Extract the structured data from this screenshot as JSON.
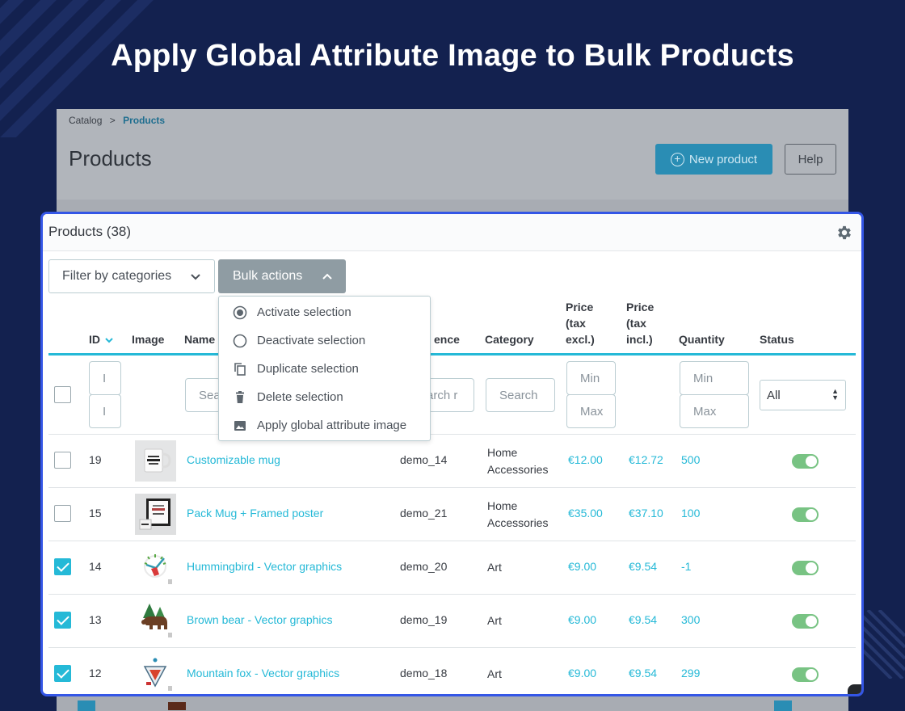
{
  "hero": {
    "title": "Apply Global Attribute Image to Bulk Products"
  },
  "background_page": {
    "breadcrumb": {
      "parent": "Catalog",
      "separator": ">",
      "current": "Products"
    },
    "title": "Products",
    "new_product_label": "New product",
    "help_label": "Help"
  },
  "panel": {
    "title": "Products (38)",
    "filter_label": "Filter by categories",
    "bulk_label": "Bulk actions"
  },
  "bulk_menu": [
    {
      "label": "Activate selection",
      "icon": "radio-checked-icon"
    },
    {
      "label": "Deactivate selection",
      "icon": "radio-empty-icon"
    },
    {
      "label": "Duplicate selection",
      "icon": "copy-icon"
    },
    {
      "label": "Delete selection",
      "icon": "trash-icon"
    },
    {
      "label": "Apply global attribute image",
      "icon": "image-icon"
    }
  ],
  "columns": {
    "id": "ID",
    "image": "Image",
    "name": "Name",
    "reference": "ence",
    "category": "Category",
    "price_excl": [
      "Price",
      "(tax",
      "excl.)"
    ],
    "price_incl": [
      "Price",
      "(tax",
      "incl.)"
    ],
    "quantity": "Quantity",
    "status": "Status"
  },
  "filters": {
    "id_min": "I",
    "id_max": "I",
    "name_placeholder": "Sea",
    "reference_placeholder": "arch r",
    "category_placeholder": "Search",
    "price_min": "Min",
    "price_max": "Max",
    "qty_min": "Min",
    "qty_max": "Max",
    "status_value": "All"
  },
  "rows": [
    {
      "checked": false,
      "id": "19",
      "image": "mug-thumbnail",
      "name": "Customizable mug",
      "reference": "demo_14",
      "category": [
        "Home",
        "Accessories"
      ],
      "price_excl": "€12.00",
      "price_incl": "€12.72",
      "quantity": "500",
      "status": "enabled"
    },
    {
      "checked": false,
      "id": "15",
      "image": "framed-poster-thumbnail",
      "name": "Pack Mug + Framed poster",
      "reference": "demo_21",
      "category": [
        "Home",
        "Accessories"
      ],
      "price_excl": "€35.00",
      "price_incl": "€37.10",
      "quantity": "100",
      "status": "enabled"
    },
    {
      "checked": true,
      "id": "14",
      "image": "hummingbird-thumbnail",
      "name": "Hummingbird - Vector graphics",
      "reference": "demo_20",
      "category": [
        "Art"
      ],
      "price_excl": "€9.00",
      "price_incl": "€9.54",
      "quantity": "-1",
      "status": "enabled"
    },
    {
      "checked": true,
      "id": "13",
      "image": "brown-bear-thumbnail",
      "name": "Brown bear - Vector graphics",
      "reference": "demo_19",
      "category": [
        "Art"
      ],
      "price_excl": "€9.00",
      "price_incl": "€9.54",
      "quantity": "300",
      "status": "enabled"
    },
    {
      "checked": true,
      "id": "12",
      "image": "mountain-fox-thumbnail",
      "name": "Mountain fox - Vector graphics",
      "reference": "demo_18",
      "category": [
        "Art"
      ],
      "price_excl": "€9.00",
      "price_incl": "€9.54",
      "quantity": "299",
      "status": "enabled"
    }
  ],
  "colors": {
    "page_bg": "#13214f",
    "accent": "#25b9d7",
    "panel_border": "#3456e6",
    "toggle_on": "#78c383",
    "bulk_button": "#8f9ca3"
  }
}
